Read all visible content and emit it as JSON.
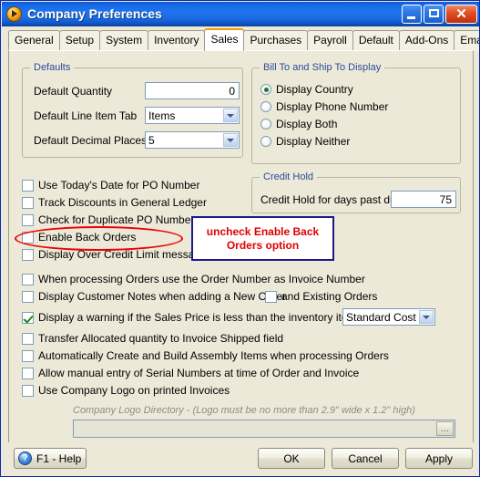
{
  "window": {
    "title": "Company Preferences",
    "icon": "app-orange-circle-icon",
    "minimize_label": "",
    "maximize_label": "",
    "close_label": "✕"
  },
  "tabs": [
    {
      "label": "General",
      "active": false
    },
    {
      "label": "Setup",
      "active": false
    },
    {
      "label": "System",
      "active": false
    },
    {
      "label": "Inventory",
      "active": false
    },
    {
      "label": "Sales",
      "active": true
    },
    {
      "label": "Purchases",
      "active": false
    },
    {
      "label": "Payroll",
      "active": false
    },
    {
      "label": "Default",
      "active": false
    },
    {
      "label": "Add-Ons",
      "active": false
    },
    {
      "label": "Email Setup",
      "active": false
    }
  ],
  "defaults": {
    "legend": "Defaults",
    "quantity_label": "Default Quantity",
    "quantity_value": "0",
    "line_item_tab_label": "Default Line Item Tab",
    "line_item_tab_value": "Items",
    "decimal_places_label": "Default Decimal Places",
    "decimal_places_value": "5"
  },
  "bill_ship": {
    "legend": "Bill To and Ship To Display",
    "options": [
      {
        "label": "Display Country",
        "selected": true
      },
      {
        "label": "Display Phone Number",
        "selected": false
      },
      {
        "label": "Display Both",
        "selected": false
      },
      {
        "label": "Display Neither",
        "selected": false
      }
    ]
  },
  "credit_hold": {
    "legend": "Credit Hold",
    "days_label": "Credit Hold for days past due",
    "days_value": "75"
  },
  "checkboxes": [
    {
      "label": "Use Today's Date for PO Number",
      "checked": false
    },
    {
      "label": "Track Discounts in General Ledger",
      "checked": false
    },
    {
      "label": "Check for Duplicate PO Number",
      "checked": false
    },
    {
      "label": "Enable Back Orders",
      "checked": false
    },
    {
      "label": "Display Over Credit Limit message",
      "checked": false
    },
    {
      "label": "When processing Orders use the Order Number as Invoice Number",
      "checked": false
    },
    {
      "label": "Display Customer Notes when adding a New Order",
      "checked": false
    },
    {
      "label": "Display a warning if the Sales Price is less than the inventory items",
      "checked": true
    },
    {
      "label": "Transfer Allocated quantity to Invoice Shipped field",
      "checked": false
    },
    {
      "label": "Automatically Create and Build Assembly Items when processing Orders",
      "checked": false
    },
    {
      "label": "Allow manual entry of Serial Numbers at time of Order and Invoice",
      "checked": false
    },
    {
      "label": "Use Company Logo on printed Invoices",
      "checked": false
    }
  ],
  "existing_orders": {
    "label": "and Existing Orders",
    "checked": false
  },
  "cost_basis": {
    "value": "Standard Cost"
  },
  "logo": {
    "caption": "Company Logo Directory - (Logo must be no more than 2.9\" wide x 1.2\" high)",
    "path_value": "",
    "browse_label": "..."
  },
  "annotation": {
    "text": "uncheck Enable Back Orders option",
    "box_border_color": "#1a1a8c",
    "text_color": "#e00000",
    "ellipse_color": "#ee0000"
  },
  "footer": {
    "help_label": "F1 - Help",
    "help_icon_glyph": "?",
    "ok_label": "OK",
    "cancel_label": "Cancel",
    "apply_label": "Apply"
  }
}
